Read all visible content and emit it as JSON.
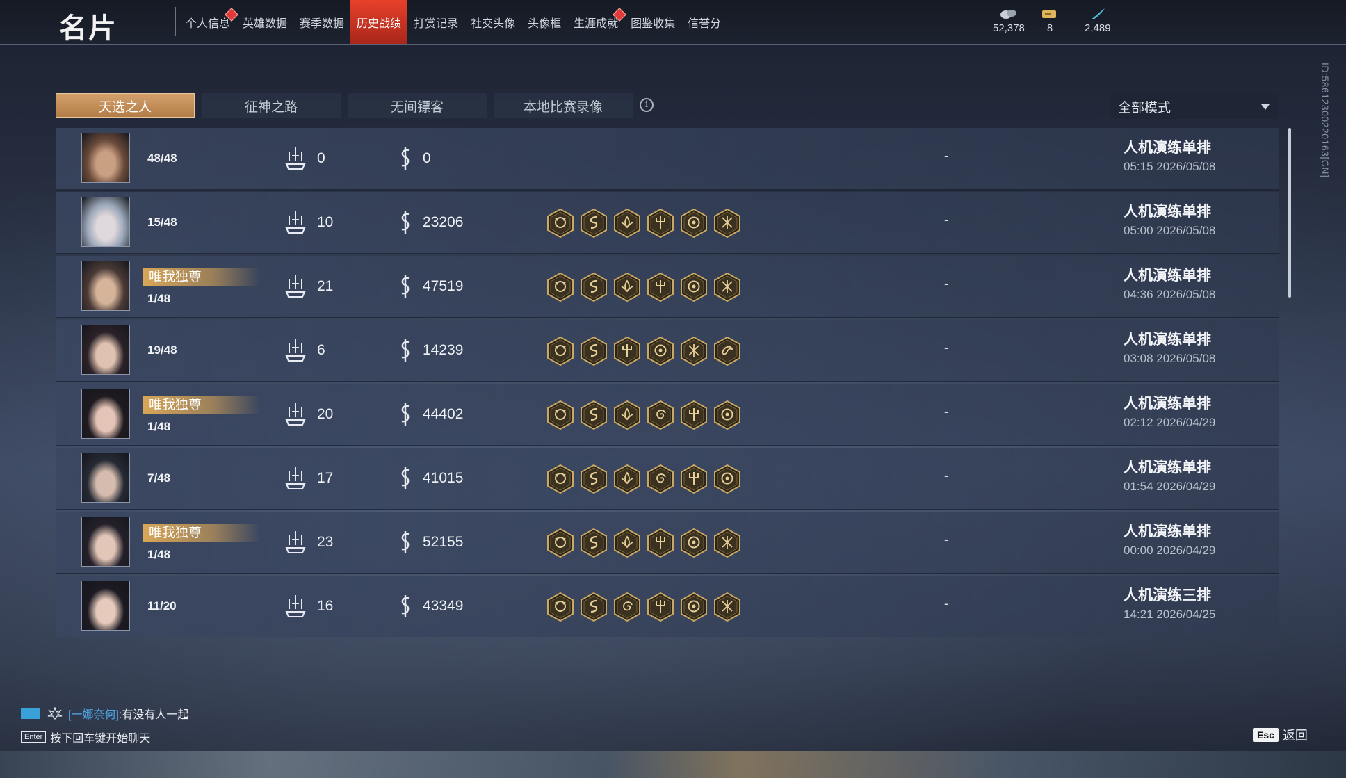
{
  "header": {
    "title": "名片",
    "nav": [
      {
        "label": "个人信息",
        "active": false,
        "dot": true
      },
      {
        "label": "英雄数据",
        "active": false,
        "dot": false
      },
      {
        "label": "赛季数据",
        "active": false,
        "dot": false
      },
      {
        "label": "历史战绩",
        "active": true,
        "dot": false
      },
      {
        "label": "打赏记录",
        "active": false,
        "dot": false
      },
      {
        "label": "社交头像",
        "active": false,
        "dot": false
      },
      {
        "label": "头像框",
        "active": false,
        "dot": false
      },
      {
        "label": "生涯成就",
        "active": false,
        "dot": true
      },
      {
        "label": "图鉴收集",
        "active": false,
        "dot": false
      },
      {
        "label": "信誉分",
        "active": false,
        "dot": false
      }
    ],
    "currencies": [
      {
        "icon": "coin-stack-icon",
        "value": "52,378"
      },
      {
        "icon": "ticket-icon",
        "value": "8"
      },
      {
        "icon": "feather-icon",
        "value": "2,489"
      }
    ]
  },
  "tabs": [
    "天选之人",
    "征神之路",
    "无间镖客",
    "本地比赛录像"
  ],
  "mode_select": "全部模式",
  "player_id": "ID:5861230022016​3[CN]",
  "title_badge": "唯我独尊",
  "matches": [
    {
      "rank": "48/48",
      "badge": false,
      "kills": "0",
      "money": "0",
      "items": [],
      "extra": "-",
      "type": "人机演练单排",
      "time": "05:15  2026/05/08"
    },
    {
      "rank": "15/48",
      "badge": false,
      "kills": "10",
      "money": "23206",
      "items": [
        "demon",
        "serpent",
        "lotus",
        "trident",
        "wheel",
        "cross"
      ],
      "extra": "-",
      "type": "人机演练单排",
      "time": "05:00  2026/05/08"
    },
    {
      "rank": "1/48",
      "badge": true,
      "kills": "21",
      "money": "47519",
      "items": [
        "demon",
        "serpent",
        "lotus",
        "trident",
        "wheel",
        "cross"
      ],
      "extra": "-",
      "type": "人机演练单排",
      "time": "04:36  2026/05/08"
    },
    {
      "rank": "19/48",
      "badge": false,
      "kills": "6",
      "money": "14239",
      "items": [
        "demon",
        "serpent",
        "trident",
        "wheel",
        "cross",
        "dragon"
      ],
      "extra": "-",
      "type": "人机演练单排",
      "time": "03:08  2026/05/08"
    },
    {
      "rank": "1/48",
      "badge": true,
      "kills": "20",
      "money": "44402",
      "items": [
        "demon",
        "serpent",
        "lotus",
        "spiral",
        "trident",
        "wheel"
      ],
      "extra": "-",
      "type": "人机演练单排",
      "time": "02:12  2026/04/29"
    },
    {
      "rank": "7/48",
      "badge": false,
      "kills": "17",
      "money": "41015",
      "items": [
        "demon",
        "serpent",
        "lotus",
        "spiral",
        "trident",
        "wheel"
      ],
      "extra": "-",
      "type": "人机演练单排",
      "time": "01:54  2026/04/29"
    },
    {
      "rank": "1/48",
      "badge": true,
      "kills": "23",
      "money": "52155",
      "items": [
        "demon",
        "serpent",
        "lotus",
        "trident",
        "wheel",
        "cross"
      ],
      "extra": "-",
      "type": "人机演练单排",
      "time": "00:00  2026/04/29"
    },
    {
      "rank": "11/20",
      "badge": false,
      "kills": "16",
      "money": "43349",
      "items": [
        "demon",
        "serpent",
        "spiral",
        "trident",
        "wheel",
        "cross"
      ],
      "extra": "-",
      "type": "人机演练三排",
      "time": "14:21  2026/04/25"
    }
  ],
  "chat": {
    "sender": "[一娜奈何]",
    "message": ":有没有人一起",
    "hint_key": "Enter",
    "hint": "按下回车键开始聊天"
  },
  "back": {
    "key": "Esc",
    "label": "返回"
  },
  "colors": {
    "accent_nav": "#e6412a",
    "tab_active": "#d3a06b",
    "badge": "#d9a657"
  }
}
